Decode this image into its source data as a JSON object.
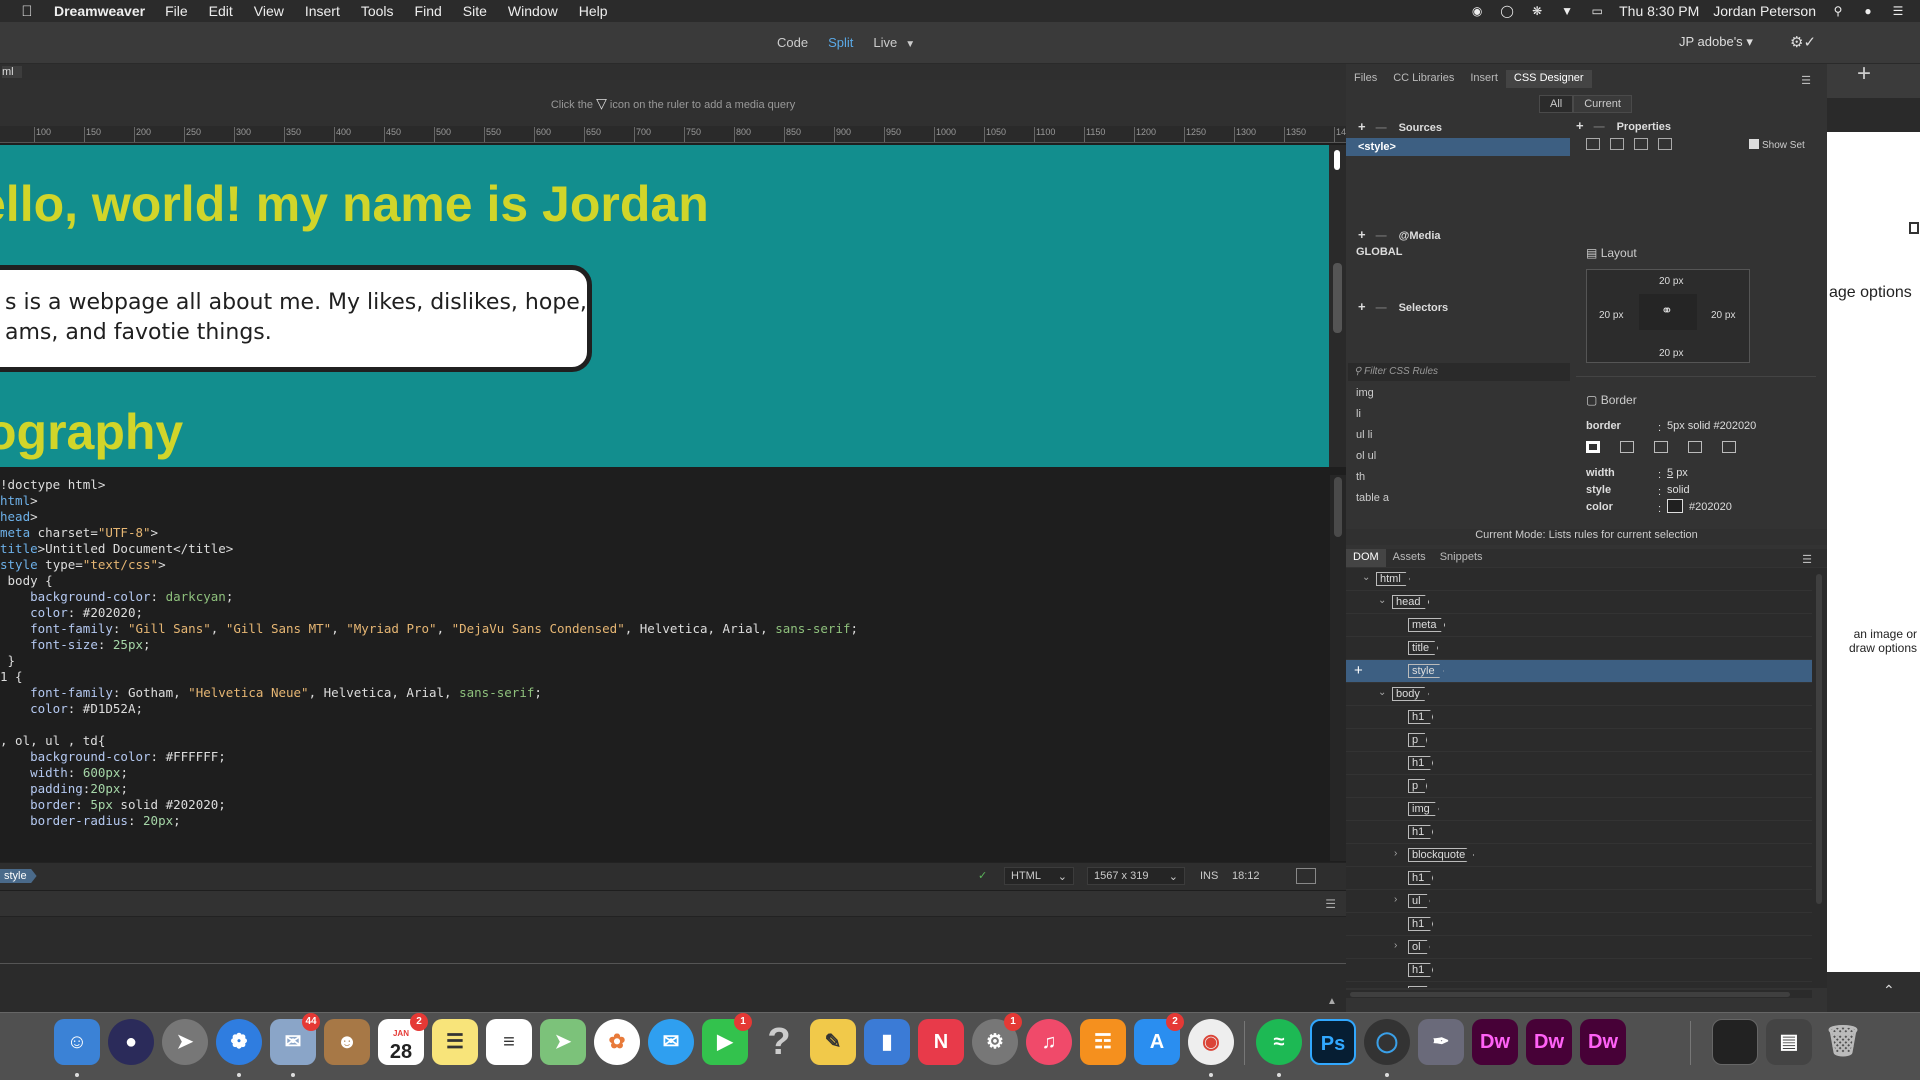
{
  "menubar": {
    "app_name": "Dreamweaver",
    "menus": [
      "File",
      "Edit",
      "View",
      "Insert",
      "Tools",
      "Find",
      "Site",
      "Window",
      "Help"
    ],
    "clock": "Thu 8:30 PM",
    "user": "Jordan Peterson"
  },
  "toolbar": {
    "views": [
      "Code",
      "Split",
      "Live"
    ],
    "active_view": "Split",
    "account": "JP adobe's",
    "account_caret": "▾",
    "gear": "⚙✓"
  },
  "document": {
    "tab_label": "ml",
    "media_query_hint_pre": "Click the",
    "media_query_hint_post": "icon on the ruler to add a media query",
    "ruler_ticks": [
      "100",
      "150",
      "200",
      "250",
      "300",
      "350",
      "400",
      "450",
      "500",
      "550",
      "600",
      "650",
      "700",
      "750",
      "800",
      "850",
      "900",
      "950",
      "1000",
      "1050",
      "1100",
      "1150",
      "1200",
      "1250",
      "1300",
      "1350",
      "14"
    ]
  },
  "live_view": {
    "heading1": "ello, world! my name is Jordan",
    "paragraph_line1": "s is a webpage all about me. My likes, dislikes, hope,",
    "paragraph_line2": "ams, and favotie things.",
    "heading2": "ography",
    "bg_color": "#128e8e",
    "heading_color": "#D1D52A"
  },
  "code_view": {
    "lines": [
      "!doctype html>",
      "html>",
      "head>",
      "meta charset=\"UTF-8\">",
      "title>Untitled Document</title>",
      "style type=\"text/css\">",
      " body {",
      "    background-color: darkcyan;",
      "    color: #202020;",
      "    font-family: \"Gill Sans\", \"Gill Sans MT\", \"Myriad Pro\", \"DejaVu Sans Condensed\", Helvetica, Arial, sans-serif;",
      "    font-size: 25px;",
      " }",
      "1 {",
      "    font-family: Gotham, \"Helvetica Neue\", Helvetica, Arial, sans-serif;",
      "    color: #D1D52A;",
      "",
      ", ol, ul , td{",
      "    background-color: #FFFFFF;",
      "    width: 600px;",
      "    padding:20px;",
      "    border: 5px solid #202020;",
      "    border-radius: 20px;"
    ]
  },
  "status_bar": {
    "tag": "style",
    "language": "HTML",
    "size": "1567 x 319",
    "mode": "INS",
    "cursor": "18:12"
  },
  "panel": {
    "tabs": [
      "Files",
      "CC Libraries",
      "Insert",
      "CSS Designer"
    ],
    "active_tab": "CSS Designer",
    "sub_tabs": [
      "All",
      "Current"
    ],
    "sources_title": "Sources",
    "sources_selected": "<style>",
    "media_title": "@Media",
    "media_item": "GLOBAL",
    "selectors_title": "Selectors",
    "filter_placeholder": "Filter CSS Rules",
    "selectors": [
      "img",
      "li",
      "ul li",
      "ol ul",
      "th",
      "table a"
    ],
    "properties_title": "Properties",
    "show_set": "Show Set",
    "layout_label": "Layout",
    "width_label": "width",
    "width_value": "600",
    "width_unit": "px",
    "padding_label": "padding",
    "padding_value": "20px",
    "pad_top": "20 px",
    "pad_left": "20 px",
    "pad_right": "20 px",
    "pad_bottom": "20 px",
    "border_section": "Border",
    "border_label": "border",
    "border_value": "5px solid #202020",
    "bw_label": "width",
    "bw_value": "5",
    "bw_unit": "px",
    "bstyle_label": "style",
    "bstyle_value": "solid",
    "bcolor_label": "color",
    "bcolor_value": "#202020",
    "current_mode": "Current Mode: Lists rules for current selection"
  },
  "dom_panel": {
    "tabs": [
      "DOM",
      "Assets",
      "Snippets"
    ],
    "active_tab": "DOM",
    "nodes": [
      "html",
      "head",
      "meta",
      "title",
      "style",
      "body",
      "h1",
      "p",
      "h1",
      "p",
      "img",
      "h1",
      "blockquote",
      "h1",
      "ul",
      "h1",
      "ol",
      "h1",
      "ol"
    ]
  },
  "side_window": {
    "text1": "age options",
    "text2": "an image or draw options"
  },
  "dock": {
    "calendar_month": "JAN",
    "calendar_day": "28",
    "badge_mail": "44",
    "badge_calendar": "2",
    "badge_facetime": "1",
    "badge_prefs": "1",
    "badge_appstore": "2",
    "help_glyph": "?",
    "ps_label": "Ps",
    "dw_label": "Dw"
  }
}
